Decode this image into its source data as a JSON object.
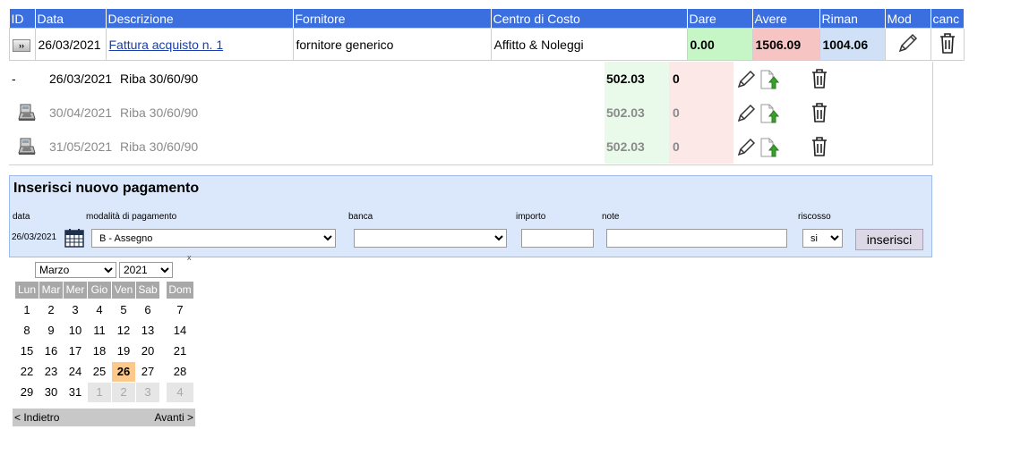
{
  "table": {
    "headers": [
      "ID",
      "Data",
      "Descrizione",
      "Fornitore",
      "Centro di Costo",
      "Dare",
      "Avere",
      "Riman",
      "Mod",
      "canc"
    ],
    "row": {
      "data": "26/03/2021",
      "descrizione": "Fattura acquisto n. 1",
      "fornitore": "fornitore generico",
      "centro_costo": "Affitto & Noleggi",
      "dare": "0.00",
      "avere": "1506.09",
      "riman": "1004.06"
    }
  },
  "payments": [
    {
      "marker": "-",
      "date": "26/03/2021",
      "desc": "Riba 30/60/90",
      "dare": "502.03",
      "avere": "0",
      "icon": "dash",
      "muted": false
    },
    {
      "marker": "",
      "date": "30/04/2021",
      "desc": "Riba 30/60/90",
      "dare": "502.03",
      "avere": "0",
      "icon": "cash-register-icon",
      "muted": true
    },
    {
      "marker": "",
      "date": "31/05/2021",
      "desc": "Riba 30/60/90",
      "dare": "502.03",
      "avere": "0",
      "icon": "cash-register-icon",
      "muted": true
    }
  ],
  "form": {
    "title": "Inserisci nuovo pagamento",
    "labels": {
      "data": "data",
      "modalita": "modalità di pagamento",
      "banca": "banca",
      "importo": "importo",
      "note": "note",
      "riscosso": "riscosso"
    },
    "date_value": "26/03/2021",
    "modalita_value": "B - Assegno",
    "banca_value": "",
    "importo_value": "",
    "note_value": "",
    "riscosso_value": "si",
    "submit": "inserisci",
    "close_mark": "x"
  },
  "calendar": {
    "month": "Marzo",
    "year": "2021",
    "weekdays": [
      "Lun",
      "Mar",
      "Mer",
      "Gio",
      "Ven",
      "Sab",
      "Dom"
    ],
    "weeks": [
      [
        "1",
        "2",
        "3",
        "4",
        "5",
        "6",
        "7"
      ],
      [
        "8",
        "9",
        "10",
        "11",
        "12",
        "13",
        "14"
      ],
      [
        "15",
        "16",
        "17",
        "18",
        "19",
        "20",
        "21"
      ],
      [
        "22",
        "23",
        "24",
        "25",
        "26",
        "27",
        "28"
      ],
      [
        "29",
        "30",
        "31",
        "1",
        "2",
        "3",
        "4"
      ]
    ],
    "selected_day": "26",
    "prev": "< Indietro",
    "next": "Avanti >"
  },
  "colors": {
    "header_bg": "#3b6fe0",
    "dare_bg": "#c6f5c6",
    "avere_bg": "#f7c4c4",
    "riman_bg": "#cfe0f7",
    "form_bg": "#dbe8fb",
    "today_bg": "#fcc98a"
  }
}
